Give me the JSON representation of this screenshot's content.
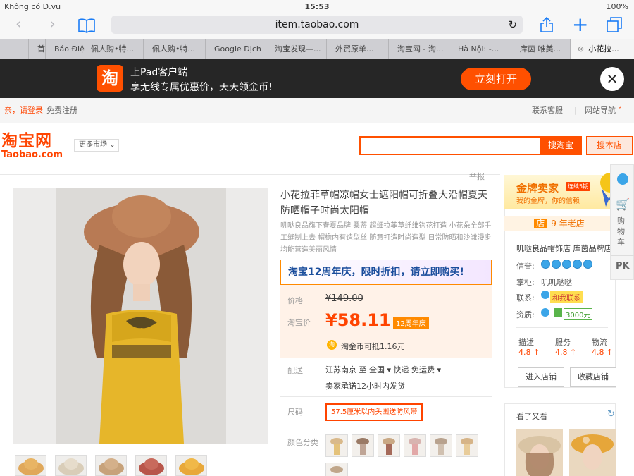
{
  "status": {
    "carrier": "Không có D.vụ",
    "time": "15:53",
    "battery": "100%"
  },
  "browser": {
    "url": "item.taobao.com",
    "tabs": [
      "首",
      "Báo Điệi",
      "佩人购•特...",
      "佩人购•特...",
      "Google Dịch",
      "淘宝发现—...",
      "外贸原单...",
      "淘宝网 - 淘...",
      "Hà Nội: -...",
      "库茵 唯美...",
      "小花拉..."
    ]
  },
  "banner": {
    "logo_char": "淘",
    "line1": "上Pad客户端",
    "line2": "享无线专属优惠价，天天领金币!",
    "open": "立刻打开"
  },
  "sitenav": {
    "login": "亲，请登录",
    "register": "免费注册",
    "service": "联系客服",
    "sitemap": "网站导航"
  },
  "header": {
    "logo_cn": "淘宝网",
    "logo_en": "Taobao.com",
    "market": "更多市场",
    "search_btn": "搜淘宝",
    "search_shop": "搜本店"
  },
  "product": {
    "report": "举报",
    "title": "小花拉菲草帽凉帽女士遮阳帽可折叠大沿帽夏天防晒帽子时尚太阳帽",
    "subtitle": "叽哒良品旗下春夏品牌 桑蒂 超细拉菲草纤维钩花打造 小花朵全部手工缝制上去 帽檐内有造型丝 随意打造时尚造型 日常防晒和沙滩漫步均能营造美丽风情",
    "promo": "淘宝12周年庆，限时折扣，请立即购买!",
    "price_label": "价格",
    "old_price": "¥149.00",
    "tb_price_label": "淘宝价",
    "new_price": "¥58.11",
    "anniversary": "12周年庆",
    "coin_text": "淘金币可抵1.16元",
    "ship_label": "配送",
    "ship_line": "江苏南京 至  全国 ▾    快递 免运费 ▾",
    "ship_promise": "卖家承诺12小时内发货",
    "size_label": "尺码",
    "size_option": "57.5厘米以内头围送防风带",
    "color_label": "颜色分类"
  },
  "seller": {
    "gold_title": "金牌卖家",
    "gold_tag": "连续5期",
    "gold_sub": "我的金牌，你的信赖",
    "years": "9 年老店",
    "years_icon": "店",
    "shop_name": "叽哒良品帽饰店 库茵品牌店",
    "credit_label": "信誉:",
    "keeper_label": "掌柜:",
    "keeper": "叽叽哒哒",
    "contact_label": "联系:",
    "contact": "和我联系",
    "qual_label": "资质:",
    "qual": "3000元",
    "scores": [
      {
        "name": "描述",
        "value": "4.8 ↑"
      },
      {
        "name": "服务",
        "value": "4.8 ↑"
      },
      {
        "name": "物流",
        "value": "4.8 ↑"
      }
    ],
    "enter_store": "进入店铺",
    "fav_store": "收藏店铺",
    "seen": "看了又看"
  },
  "sidebar": {
    "cart": "购\n物\n车",
    "pk": "PK"
  }
}
